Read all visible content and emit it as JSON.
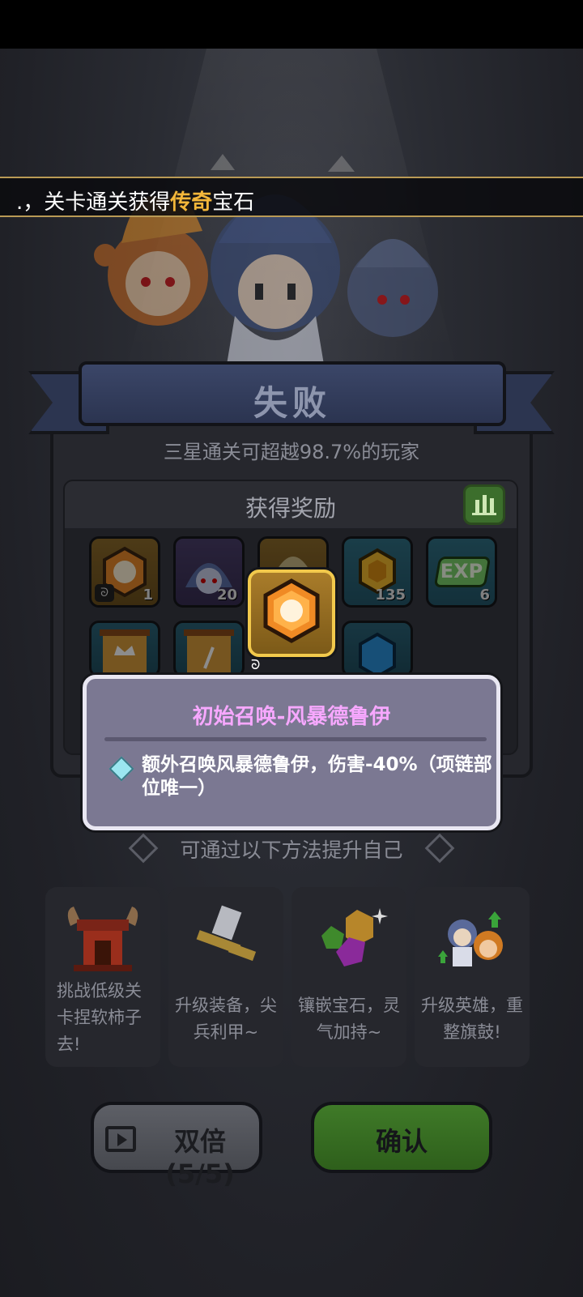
{
  "ticker": {
    "prefix": ".，关卡通关获得",
    "highlight": "传奇",
    "suffix": "宝石"
  },
  "result": {
    "title": "失败",
    "subtitle": "三星通关可超越98.7%的玩家"
  },
  "rewards": {
    "title": "获得奖励",
    "items": [
      {
        "icon": "legend-gem-icon",
        "count": "1"
      },
      {
        "icon": "hero-shard-icon",
        "count": "20"
      },
      {
        "icon": "hidden-item-icon",
        "count": ""
      },
      {
        "icon": "gold-coin-icon",
        "count": "135"
      },
      {
        "icon": "exp-icon",
        "count": "6"
      }
    ],
    "exp_label": "EXP"
  },
  "tooltip": {
    "title": "初始召唤-风暴德鲁伊",
    "description": "额外召唤风暴德鲁伊，伤害-40%（项链部位唯一）"
  },
  "improve": {
    "title": "可通过以下方法提升自己",
    "options": [
      {
        "icon": "gate-icon",
        "text": "挑战低级关卡捏软柿子去!"
      },
      {
        "icon": "equipment-icon",
        "text": "升级装备，尖兵利甲~"
      },
      {
        "icon": "gems-icon",
        "text": "镶嵌宝石，灵气加持~"
      },
      {
        "icon": "heroes-upgrade-icon",
        "text": "升级英雄，重整旗鼓!"
      }
    ]
  },
  "buttons": {
    "double": "双倍(5/5)",
    "confirm": "确认"
  },
  "colors": {
    "highlight": "#f4b73a",
    "tooltip_title": "#f7a8ff",
    "confirm_green": "#3f7a28"
  }
}
